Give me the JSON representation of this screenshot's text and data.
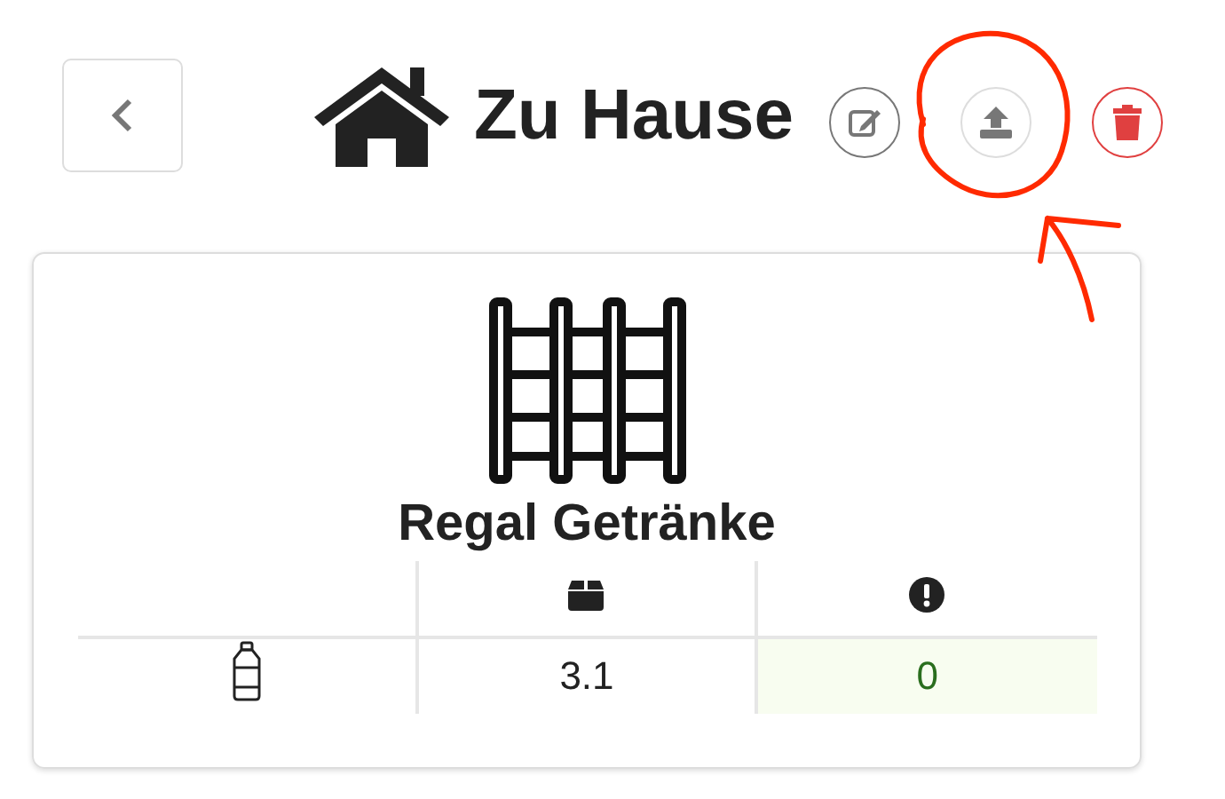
{
  "header": {
    "title": "Zu Hause"
  },
  "shelf": {
    "name": "Regal Getränke",
    "rows": [
      {
        "stock": "3.1",
        "missing": "0",
        "missing_ok": true
      }
    ]
  },
  "annotation": {
    "kind": "circle-arrow"
  }
}
